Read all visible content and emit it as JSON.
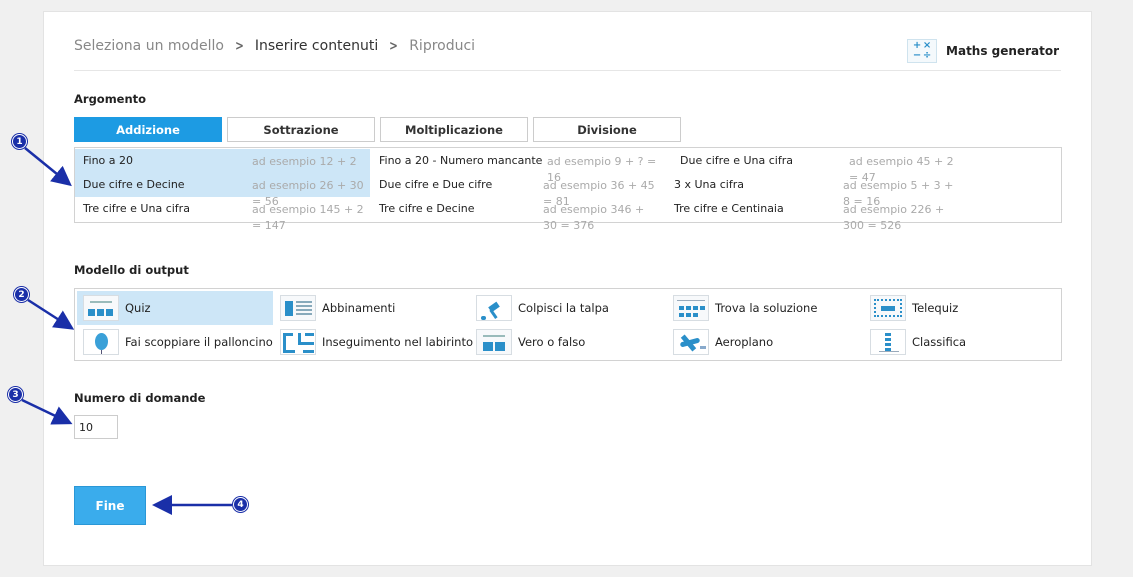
{
  "breadcrumb": {
    "step1": "Seleziona un modello",
    "step2": "Inserire contenuti",
    "step3": "Riproduci"
  },
  "maths_generator": {
    "label": "Maths generator",
    "icon": "math-operators-icon",
    "icon_glyphs": [
      "+",
      "×",
      "−",
      "÷"
    ]
  },
  "argomento": {
    "label": "Argomento",
    "tabs": [
      "Addizione",
      "Sottrazione",
      "Moltiplicazione",
      "Divisione"
    ],
    "active_tab": "Addizione",
    "topics": [
      {
        "name": "Fino a 20",
        "example": "ad esempio 12 + 2 = 14",
        "selected": true
      },
      {
        "name": "Fino a 20 - Numero mancante",
        "example": "ad esempio 9 + ? = 16",
        "selected": false
      },
      {
        "name": "Due cifre e Una cifra",
        "example": "ad esempio 45 + 2 = 47",
        "selected": false
      },
      {
        "name": "Due cifre e Decine",
        "example": "ad esempio 26 + 30 = 56",
        "selected": true
      },
      {
        "name": "Due cifre e Due cifre",
        "example": "ad esempio 36 + 45 = 81",
        "selected": false
      },
      {
        "name": "3 x Una cifra",
        "example": "ad esempio 5 + 3 + 8 = 16",
        "selected": false
      },
      {
        "name": "Tre cifre e Una cifra",
        "example": "ad esempio 145 + 2 = 147",
        "selected": false
      },
      {
        "name": "Tre cifre e Decine",
        "example": "ad esempio 346 + 30 = 376",
        "selected": false
      },
      {
        "name": "Tre cifre e Centinaia",
        "example": "ad esempio 226 + 300 = 526",
        "selected": false
      }
    ]
  },
  "output": {
    "label": "Modello di output",
    "templates": [
      {
        "name": "Quiz",
        "icon": "quiz-icon",
        "selected": true
      },
      {
        "name": "Abbinamenti",
        "icon": "match-up-icon",
        "selected": false
      },
      {
        "name": "Colpisci la talpa",
        "icon": "whack-a-mole-icon",
        "selected": false
      },
      {
        "name": "Trova la soluzione",
        "icon": "find-the-match-icon",
        "selected": false
      },
      {
        "name": "Telequiz",
        "icon": "gameshow-quiz-icon",
        "selected": false
      },
      {
        "name": "Fai scoppiare il palloncino",
        "icon": "balloon-pop-icon",
        "selected": false
      },
      {
        "name": "Inseguimento nel labirinto",
        "icon": "maze-chase-icon",
        "selected": false
      },
      {
        "name": "Vero o falso",
        "icon": "true-or-false-icon",
        "selected": false
      },
      {
        "name": "Aeroplano",
        "icon": "airplane-icon",
        "selected": false
      },
      {
        "name": "Classifica",
        "icon": "rank-order-icon",
        "selected": false
      }
    ]
  },
  "domande": {
    "label": "Numero di domande",
    "value": "10"
  },
  "fine_label": "Fine",
  "annotations": [
    "1",
    "2",
    "3",
    "4"
  ],
  "colors": {
    "accent": "#1d9be3",
    "selected_bg": "#cde6f7",
    "annotation": "#1a2fa8"
  }
}
